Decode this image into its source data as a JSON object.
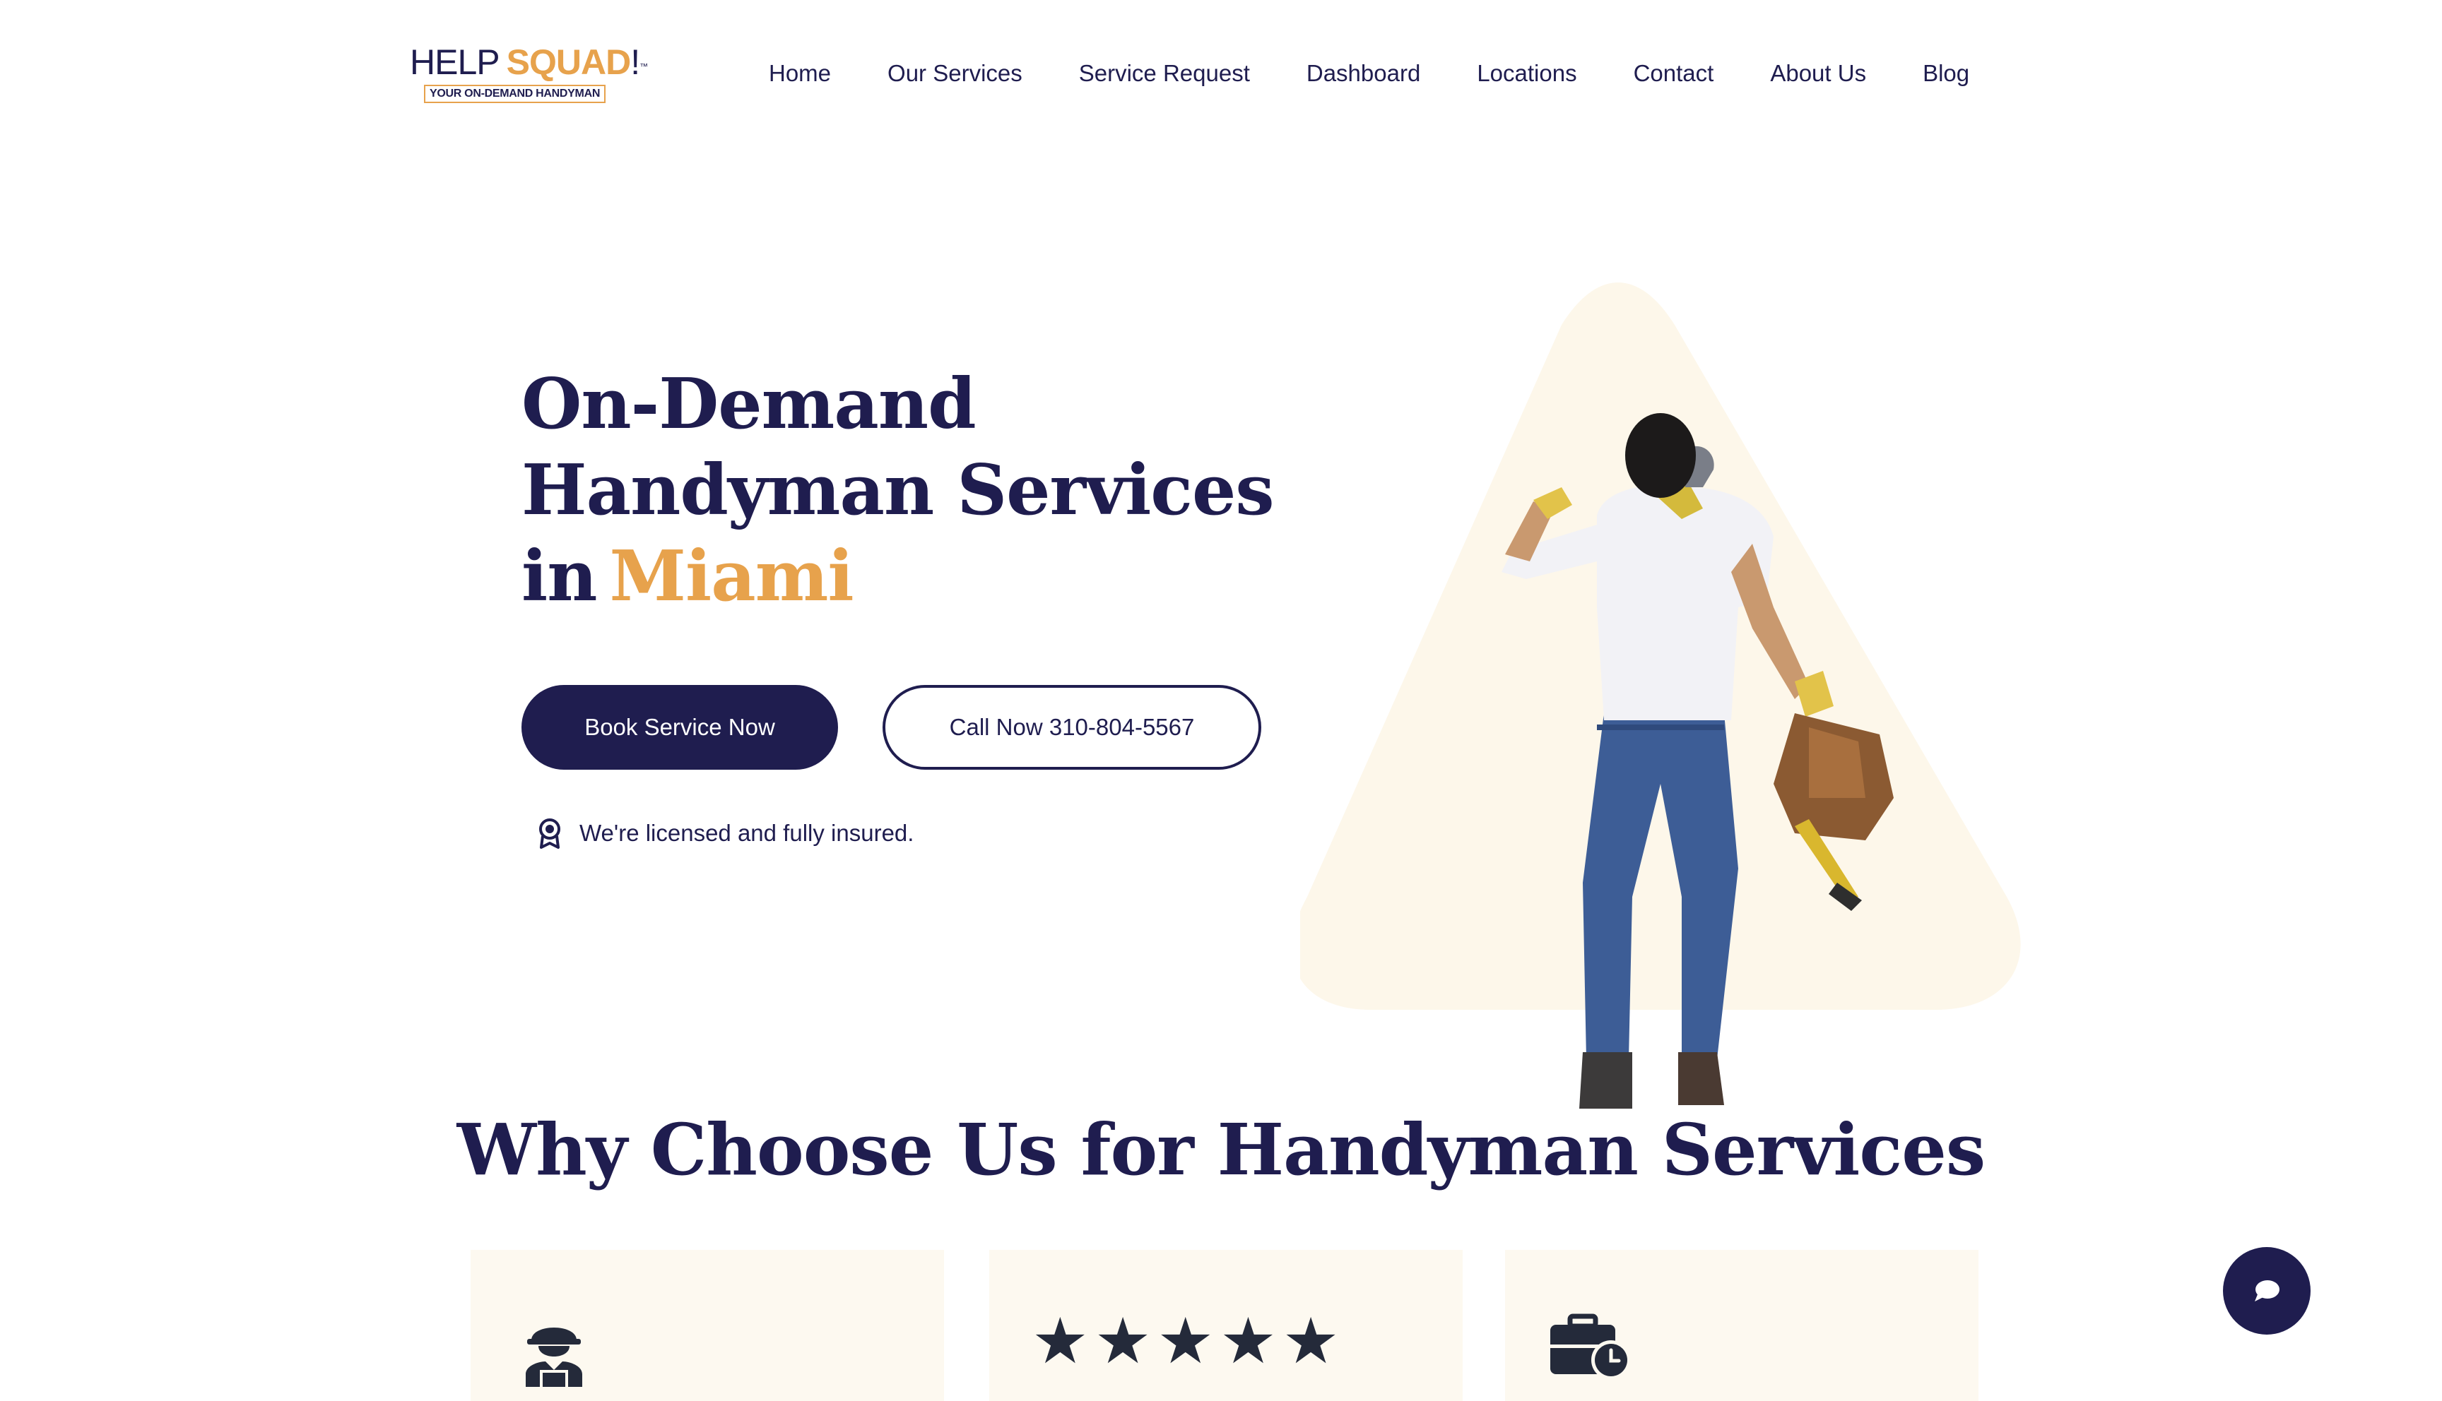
{
  "brand": {
    "name_part1": "HELP",
    "name_part2": "SQUAD",
    "name_suffix": "!",
    "trademark": "™",
    "tagline": "YOUR ON-DEMAND HANDYMAN",
    "colors": {
      "primary": "#1f1d4f",
      "accent": "#e7a24c",
      "card_background": "#fdf9f0",
      "shape_background": "#fdf7ea"
    }
  },
  "nav": {
    "items": [
      {
        "label": "Home"
      },
      {
        "label": "Our Services"
      },
      {
        "label": "Service Request"
      },
      {
        "label": "Dashboard"
      },
      {
        "label": "Locations"
      },
      {
        "label": "Contact"
      },
      {
        "label": "About Us"
      },
      {
        "label": "Blog"
      }
    ]
  },
  "hero": {
    "title_line1": "On-Demand",
    "title_line2": "Handyman Services",
    "title_line3_prefix": "in",
    "title_city": "Miami",
    "primary_button": "Book Service Now",
    "secondary_button": "Call Now 310-804-5567",
    "insured_icon": "award-badge-icon",
    "insured_text": "We're licensed and fully insured.",
    "image": "handyman-with-tool-bag-photo"
  },
  "why": {
    "title": "Why Choose Us for Handyman Services",
    "cards": [
      {
        "icon": "worker-hardhat-icon"
      },
      {
        "icon": "star-rating",
        "rating": 5,
        "star_glyph": "★"
      },
      {
        "icon": "toolbox-clock-icon"
      }
    ]
  },
  "chat": {
    "icon": "chat-bubble-icon"
  }
}
